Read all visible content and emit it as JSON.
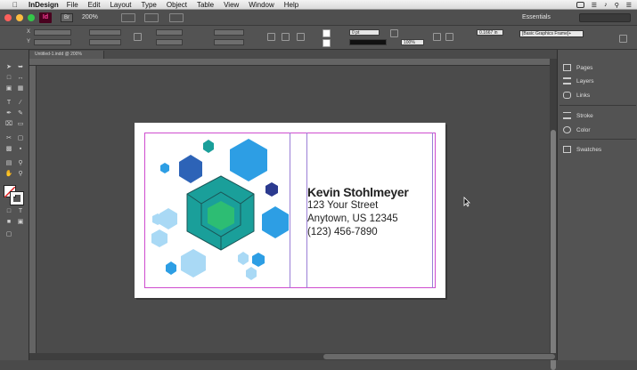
{
  "menubar": {
    "app": "InDesign",
    "items": [
      "File",
      "Edit",
      "Layout",
      "Type",
      "Object",
      "Table",
      "View",
      "Window",
      "Help"
    ]
  },
  "appbar": {
    "logo": "Id",
    "bridge": "Br",
    "zoom": "200%",
    "workspace": "Essentials"
  },
  "control": {
    "stroke_weight": "0 pt",
    "scale": "100%",
    "size": "0.1667 in",
    "object_style": "[Basic Graphics Frame]+"
  },
  "document": {
    "tab_title": "Untitled-1.indd @ 200%"
  },
  "card": {
    "name": "Kevin Stohlmeyer",
    "street": "123 Your Street",
    "city": "Anytown, US 12345",
    "phone": "(123) 456-7890"
  },
  "panels": {
    "items": [
      "Pages",
      "Layers",
      "Links",
      "Stroke",
      "Color",
      "Swatches"
    ]
  },
  "colors": {
    "teal": "#1a9f9a",
    "green": "#2dbd73",
    "blue_dark": "#2d63b7",
    "blue_mid": "#2d9ee4",
    "blue_light": "#a9d9f5",
    "navy": "#2b3a8f"
  }
}
